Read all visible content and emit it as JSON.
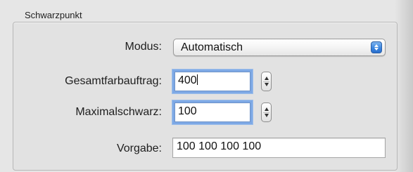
{
  "group": {
    "title": "Schwarzpunkt"
  },
  "mode": {
    "label": "Modus:",
    "value": "Automatisch",
    "icon": "chevron-up-down-icon"
  },
  "total_ink": {
    "label": "Gesamtfarbauftrag:",
    "value": "400"
  },
  "max_black": {
    "label": "Maximalschwarz:",
    "value": "100"
  },
  "default": {
    "label": "Vorgabe:",
    "value": "100 100 100 100"
  },
  "colors": {
    "focus_ring": "#7ea9e6",
    "select_arrow": "#3b86e0"
  }
}
